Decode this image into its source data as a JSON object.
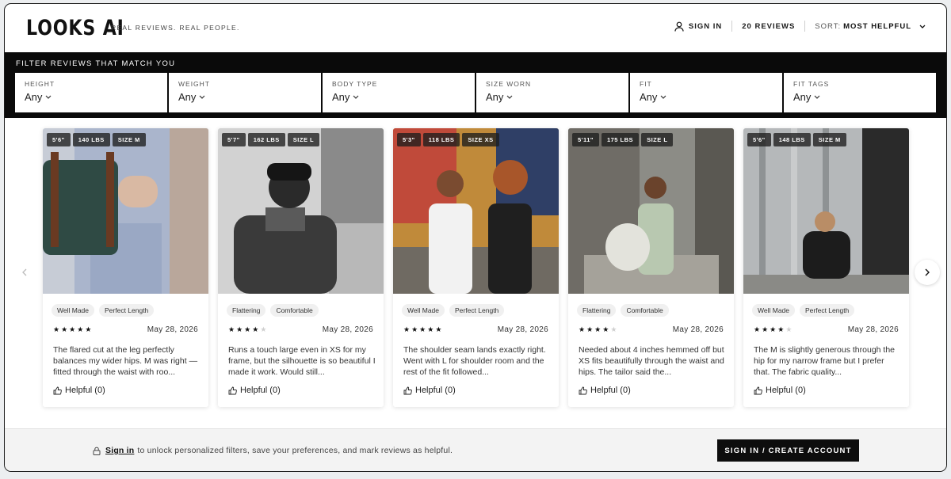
{
  "header": {
    "logo": "LOOKS AI",
    "tagline": "REAL REVIEWS. REAL PEOPLE.",
    "sign_in": "SIGN IN",
    "review_count": "20 REVIEWS",
    "sort_label": "SORT:",
    "sort_value": "MOST HELPFUL"
  },
  "filters": {
    "title": "FILTER REVIEWS THAT MATCH YOU",
    "items": [
      {
        "label": "HEIGHT",
        "value": "Any"
      },
      {
        "label": "WEIGHT",
        "value": "Any"
      },
      {
        "label": "BODY TYPE",
        "value": "Any"
      },
      {
        "label": "SIZE WORN",
        "value": "Any"
      },
      {
        "label": "FIT",
        "value": "Any"
      },
      {
        "label": "FIT TAGS",
        "value": "Any"
      }
    ]
  },
  "reviews": [
    {
      "height": "5'6\"",
      "weight": "140 LBS",
      "size": "SIZE M",
      "tags": [
        "Well Made",
        "Perfect Length"
      ],
      "rating": 5,
      "date": "May 28, 2026",
      "text": "The flared cut at the leg perfectly balances my wider hips. M was right — fitted through the waist with roo...",
      "helpful": "Helpful (0)"
    },
    {
      "height": "5'7\"",
      "weight": "162 LBS",
      "size": "SIZE L",
      "tags": [
        "Flattering",
        "Comfortable"
      ],
      "rating": 4,
      "date": "May 28, 2026",
      "text": "Runs a touch large even in XS for my frame, but the silhouette is so beautiful I made it work. Would still...",
      "helpful": "Helpful (0)"
    },
    {
      "height": "5'3\"",
      "weight": "118 LBS",
      "size": "SIZE XS",
      "tags": [
        "Well Made",
        "Perfect Length"
      ],
      "rating": 5,
      "date": "May 28, 2026",
      "text": "The shoulder seam lands exactly right. Went with L for shoulder room and the rest of the fit followed...",
      "helpful": "Helpful (0)"
    },
    {
      "height": "5'11\"",
      "weight": "175 LBS",
      "size": "SIZE L",
      "tags": [
        "Flattering",
        "Comfortable"
      ],
      "rating": 4,
      "date": "May 28, 2026",
      "text": "Needed about 4 inches hemmed off but XS fits beautifully through the waist and hips. The tailor said the...",
      "helpful": "Helpful (0)"
    },
    {
      "height": "5'6\"",
      "weight": "148 LBS",
      "size": "SIZE M",
      "tags": [
        "Well Made",
        "Perfect Length"
      ],
      "rating": 4,
      "date": "May 28, 2026",
      "text": "The M is slightly generous through the hip for my narrow frame but I prefer that. The fabric quality...",
      "helpful": "Helpful (0)"
    }
  ],
  "footer": {
    "sign_in_link": "Sign in",
    "message": "to unlock personalized filters, save your preferences, and mark reviews as helpful.",
    "cta": "SIGN IN / CREATE ACCOUNT"
  }
}
